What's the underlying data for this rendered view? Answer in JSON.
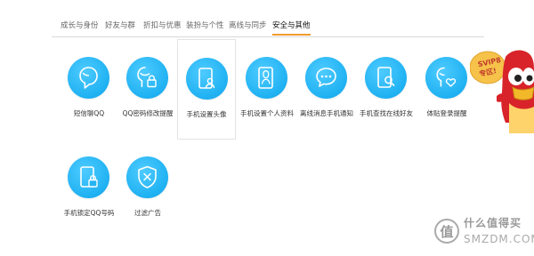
{
  "tabs": [
    {
      "label": "成长与身份"
    },
    {
      "label": "好友与群"
    },
    {
      "label": "折扣与优惠"
    },
    {
      "label": "装扮与个性"
    },
    {
      "label": "离线与同步"
    },
    {
      "label": "安全与其他",
      "active": true
    }
  ],
  "features": [
    {
      "label": "短信聊QQ",
      "icon": "person-chat-icon"
    },
    {
      "label": "QQ密码修改提醒",
      "icon": "phone-lock-icon"
    },
    {
      "label": "手机设置头像",
      "icon": "phone-avatar-icon",
      "selected": true
    },
    {
      "label": "手机设置个人资料",
      "icon": "phone-profile-icon"
    },
    {
      "label": "离线消息手机通知",
      "icon": "speech-bubble-icon"
    },
    {
      "label": "手机查找在线好友",
      "icon": "phone-search-icon"
    },
    {
      "label": "体贴登录提醒",
      "icon": "person-heart-icon"
    },
    {
      "label": "手机锁定QQ号码",
      "icon": "phone-lock-icon"
    },
    {
      "label": "过滤广告",
      "icon": "shield-x-icon"
    }
  ],
  "promo": {
    "badge_text": "SVIP8 专区！",
    "icon": "qq-mascot-icon"
  },
  "watermark": {
    "line1": "什么值得买",
    "line2": "SMZDM.COM"
  },
  "colors": {
    "accent": "#f39c2c",
    "icon_blue": "#1fb1f2"
  }
}
